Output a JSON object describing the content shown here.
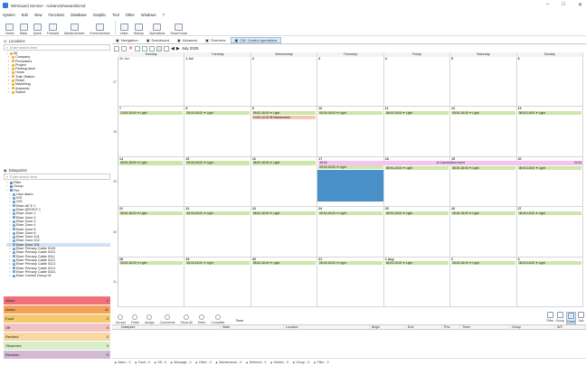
{
  "window": {
    "title": "WinGuard Service - Advancis/wwandsiend"
  },
  "menu": [
    "System",
    "Edit",
    "View",
    "Functions",
    "Database",
    "Graphic",
    "Tool",
    "Other",
    "Windows",
    "?"
  ],
  "ribbon": [
    {
      "label": "Home",
      "icon": "home-icon"
    },
    {
      "label": "Back",
      "icon": "back-icon"
    },
    {
      "label": "Quick",
      "icon": "quick-icon"
    },
    {
      "label": "Forward",
      "icon": "forward-icon"
    },
    {
      "label": "Media Archive",
      "icon": "media-archive-icon"
    },
    {
      "label": "Event Archive",
      "icon": "event-archive-icon"
    },
    {
      "label": "Video",
      "icon": "video-icon"
    },
    {
      "label": "History",
      "icon": "history-icon"
    },
    {
      "label": "Operations",
      "icon": "operations-icon"
    },
    {
      "label": "Guard book",
      "icon": "guard-book-icon"
    }
  ],
  "locations": {
    "title": "Locations",
    "search_placeholder": "Enter search term",
    "tree": [
      "All",
      "Company",
      "Perimeters",
      "Project",
      "Parking deck",
      "Home",
      "Train Station",
      "Retail",
      "Marketing",
      "Advancis",
      "Switch"
    ]
  },
  "datapoints": {
    "title": "Datapoints",
    "search_placeholder": "Enter search term",
    "tree": [
      "Filter",
      "Group",
      "Fire",
      "User alarm",
      "IVS",
      "GIS",
      "Eiser AE E 1",
      "Eiser AROS E 1",
      "Eiser Zone 1",
      "Eiser Zone 2",
      "Eiser Zone 3",
      "Eiser Zone 4",
      "Eiser Zone 5",
      "Eiser Zone 6",
      "Eiser Zone 101",
      "Eiser Zone 102",
      "Eiser Zone 201",
      "Eiser Primary Cable 0105",
      "Eiser Primary Cable 0101",
      "Eiser Primary Cable 0111",
      "Eiser Primary Cable 0112",
      "Eiser Primary Cable 0113",
      "Eiser Primary Cable 0114",
      "Eiser Primary Cable 0161",
      "Eiser Control Group 01"
    ],
    "selected_index": 16
  },
  "categories": [
    {
      "label": "Alarm",
      "count": "1",
      "color": "#f0707a"
    },
    {
      "label": "Active",
      "count": "11",
      "color": "#f4a25b"
    },
    {
      "label": "Fault",
      "count": "0",
      "color": "#f3c96b"
    },
    {
      "label": "Off",
      "count": "0",
      "color": "#f3c2c2"
    },
    {
      "label": "Revised",
      "count": "0",
      "color": "#f6d8a0"
    },
    {
      "label": "Observed",
      "count": "0",
      "color": "#d8eec8"
    },
    {
      "label": "Revision",
      "count": "0",
      "color": "#d4b9d4"
    }
  ],
  "tabs": [
    {
      "label": "Navigation",
      "icon": "navigation-icon",
      "active": false
    },
    {
      "label": "Dashboard",
      "icon": "dashboard-icon",
      "active": false
    },
    {
      "label": "Advancis",
      "icon": "globe-icon",
      "active": false
    },
    {
      "label": "Overview",
      "icon": "overview-icon",
      "active": false
    },
    {
      "label": "CM: Control operations",
      "icon": "calendar-icon",
      "active": true
    }
  ],
  "calendar": {
    "period": "July 2025",
    "days": [
      "Monday",
      "Tuesday",
      "Wednesday",
      "Thursday",
      "Friday",
      "Saturday",
      "Sunday"
    ],
    "weeks": [
      {
        "week": "27",
        "dates": [
          "30 Jun",
          "1 Jul",
          "2",
          "3",
          "4",
          "5",
          "6"
        ]
      },
      {
        "week": "28",
        "dates": [
          "7",
          "8",
          "9",
          "10",
          "11",
          "12",
          "13"
        ]
      },
      {
        "week": "29",
        "dates": [
          "14",
          "15",
          "16",
          "17",
          "18",
          "19",
          "20"
        ]
      },
      {
        "week": "30",
        "dates": [
          "21",
          "22",
          "23",
          "24",
          "25",
          "26",
          "27"
        ]
      },
      {
        "week": "31",
        "dates": [
          "28",
          "29",
          "30",
          "31",
          "1 Aug",
          "2",
          "3"
        ]
      }
    ],
    "light_text": "08:00-18:00",
    "light_label": "Light",
    "light_text_first": "13:00-18:00",
    "maintenance": {
      "time": "10:00-12:00",
      "label": "Maintenance"
    },
    "construction": {
      "start": "15:00",
      "label": "Construction event",
      "end": "21:00"
    },
    "thursday_light": "08:00-18:00"
  },
  "bottom_toolbar": [
    "Accept",
    "Finish",
    "Assign",
    "Comments",
    "Show All",
    "Defer",
    "Complete"
  ],
  "timer_label": "Timer",
  "columns": [
    "Datapoint",
    "State",
    "Location",
    "Begin",
    "End",
    "Prio.",
    "Timer",
    "Group",
    "WS"
  ],
  "right_filters": [
    "Filter",
    "Group",
    "Detail",
    "Ack"
  ],
  "status": [
    "Alarm - 0",
    "Fault - 0",
    "Off - 0",
    "Message - 0",
    "Other - 0",
    "Maintenance - 0",
    "Deferred - 0",
    "Hidden - 0",
    "Group - 0",
    "Filter - 0"
  ]
}
